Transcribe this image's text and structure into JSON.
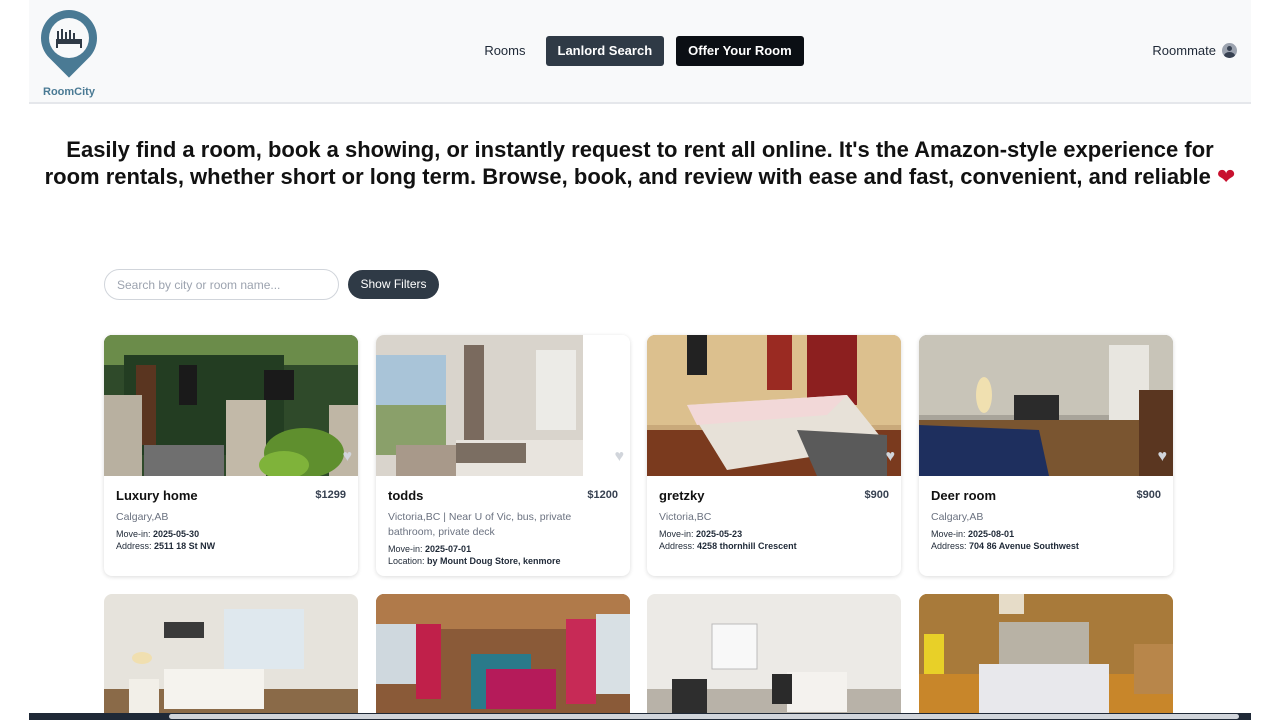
{
  "app": {
    "name": "RoomCity"
  },
  "nav": {
    "rooms": "Rooms",
    "landlord_search": "Lanlord Search",
    "offer_room": "Offer Your Room",
    "user_label": "Roommate"
  },
  "hero": {
    "line1": "Easily find a room, book a showing, or instantly request to rent all online. It's the Amazon-style experience for",
    "line2": "room rentals, whether short or long term. Browse, book, and review with ease and fast, convenient, and reliable",
    "heart": "❤"
  },
  "search": {
    "placeholder": "Search by city or room name...",
    "filters_label": "Show Filters"
  },
  "listings": [
    {
      "title": "Luxury home",
      "price": "$1299",
      "location": "Calgary,AB",
      "move_in_label": "Move-in:",
      "move_in": "2025-05-30",
      "addr_label": "Address:",
      "address": "2511 18 St NW"
    },
    {
      "title": "todds",
      "price": "$1200",
      "location": "Victoria,BC | Near U of Vic, bus, private bathroom, private deck",
      "move_in_label": "Move-in:",
      "move_in": "2025-07-01",
      "addr_label": "Location:",
      "address": "by Mount Doug Store, kenmore"
    },
    {
      "title": "gretzky",
      "price": "$900",
      "location": "Victoria,BC",
      "move_in_label": "Move-in:",
      "move_in": "2025-05-23",
      "addr_label": "Address:",
      "address": "4258 thornhill Crescent"
    },
    {
      "title": "Deer room",
      "price": "$900",
      "location": "Calgary,AB",
      "move_in_label": "Move-in:",
      "move_in": "2025-08-01",
      "addr_label": "Address:",
      "address": "704 86 Avenue Southwest"
    }
  ],
  "icons": {
    "favorite": "heart-icon",
    "user": "user-avatar-icon",
    "logo": "map-pin-bed-logo"
  },
  "colors": {
    "accent_dark": "#2f3a46",
    "black_button": "#0b0f14",
    "logo": "#4a7a94",
    "heart": "#c8102e"
  }
}
